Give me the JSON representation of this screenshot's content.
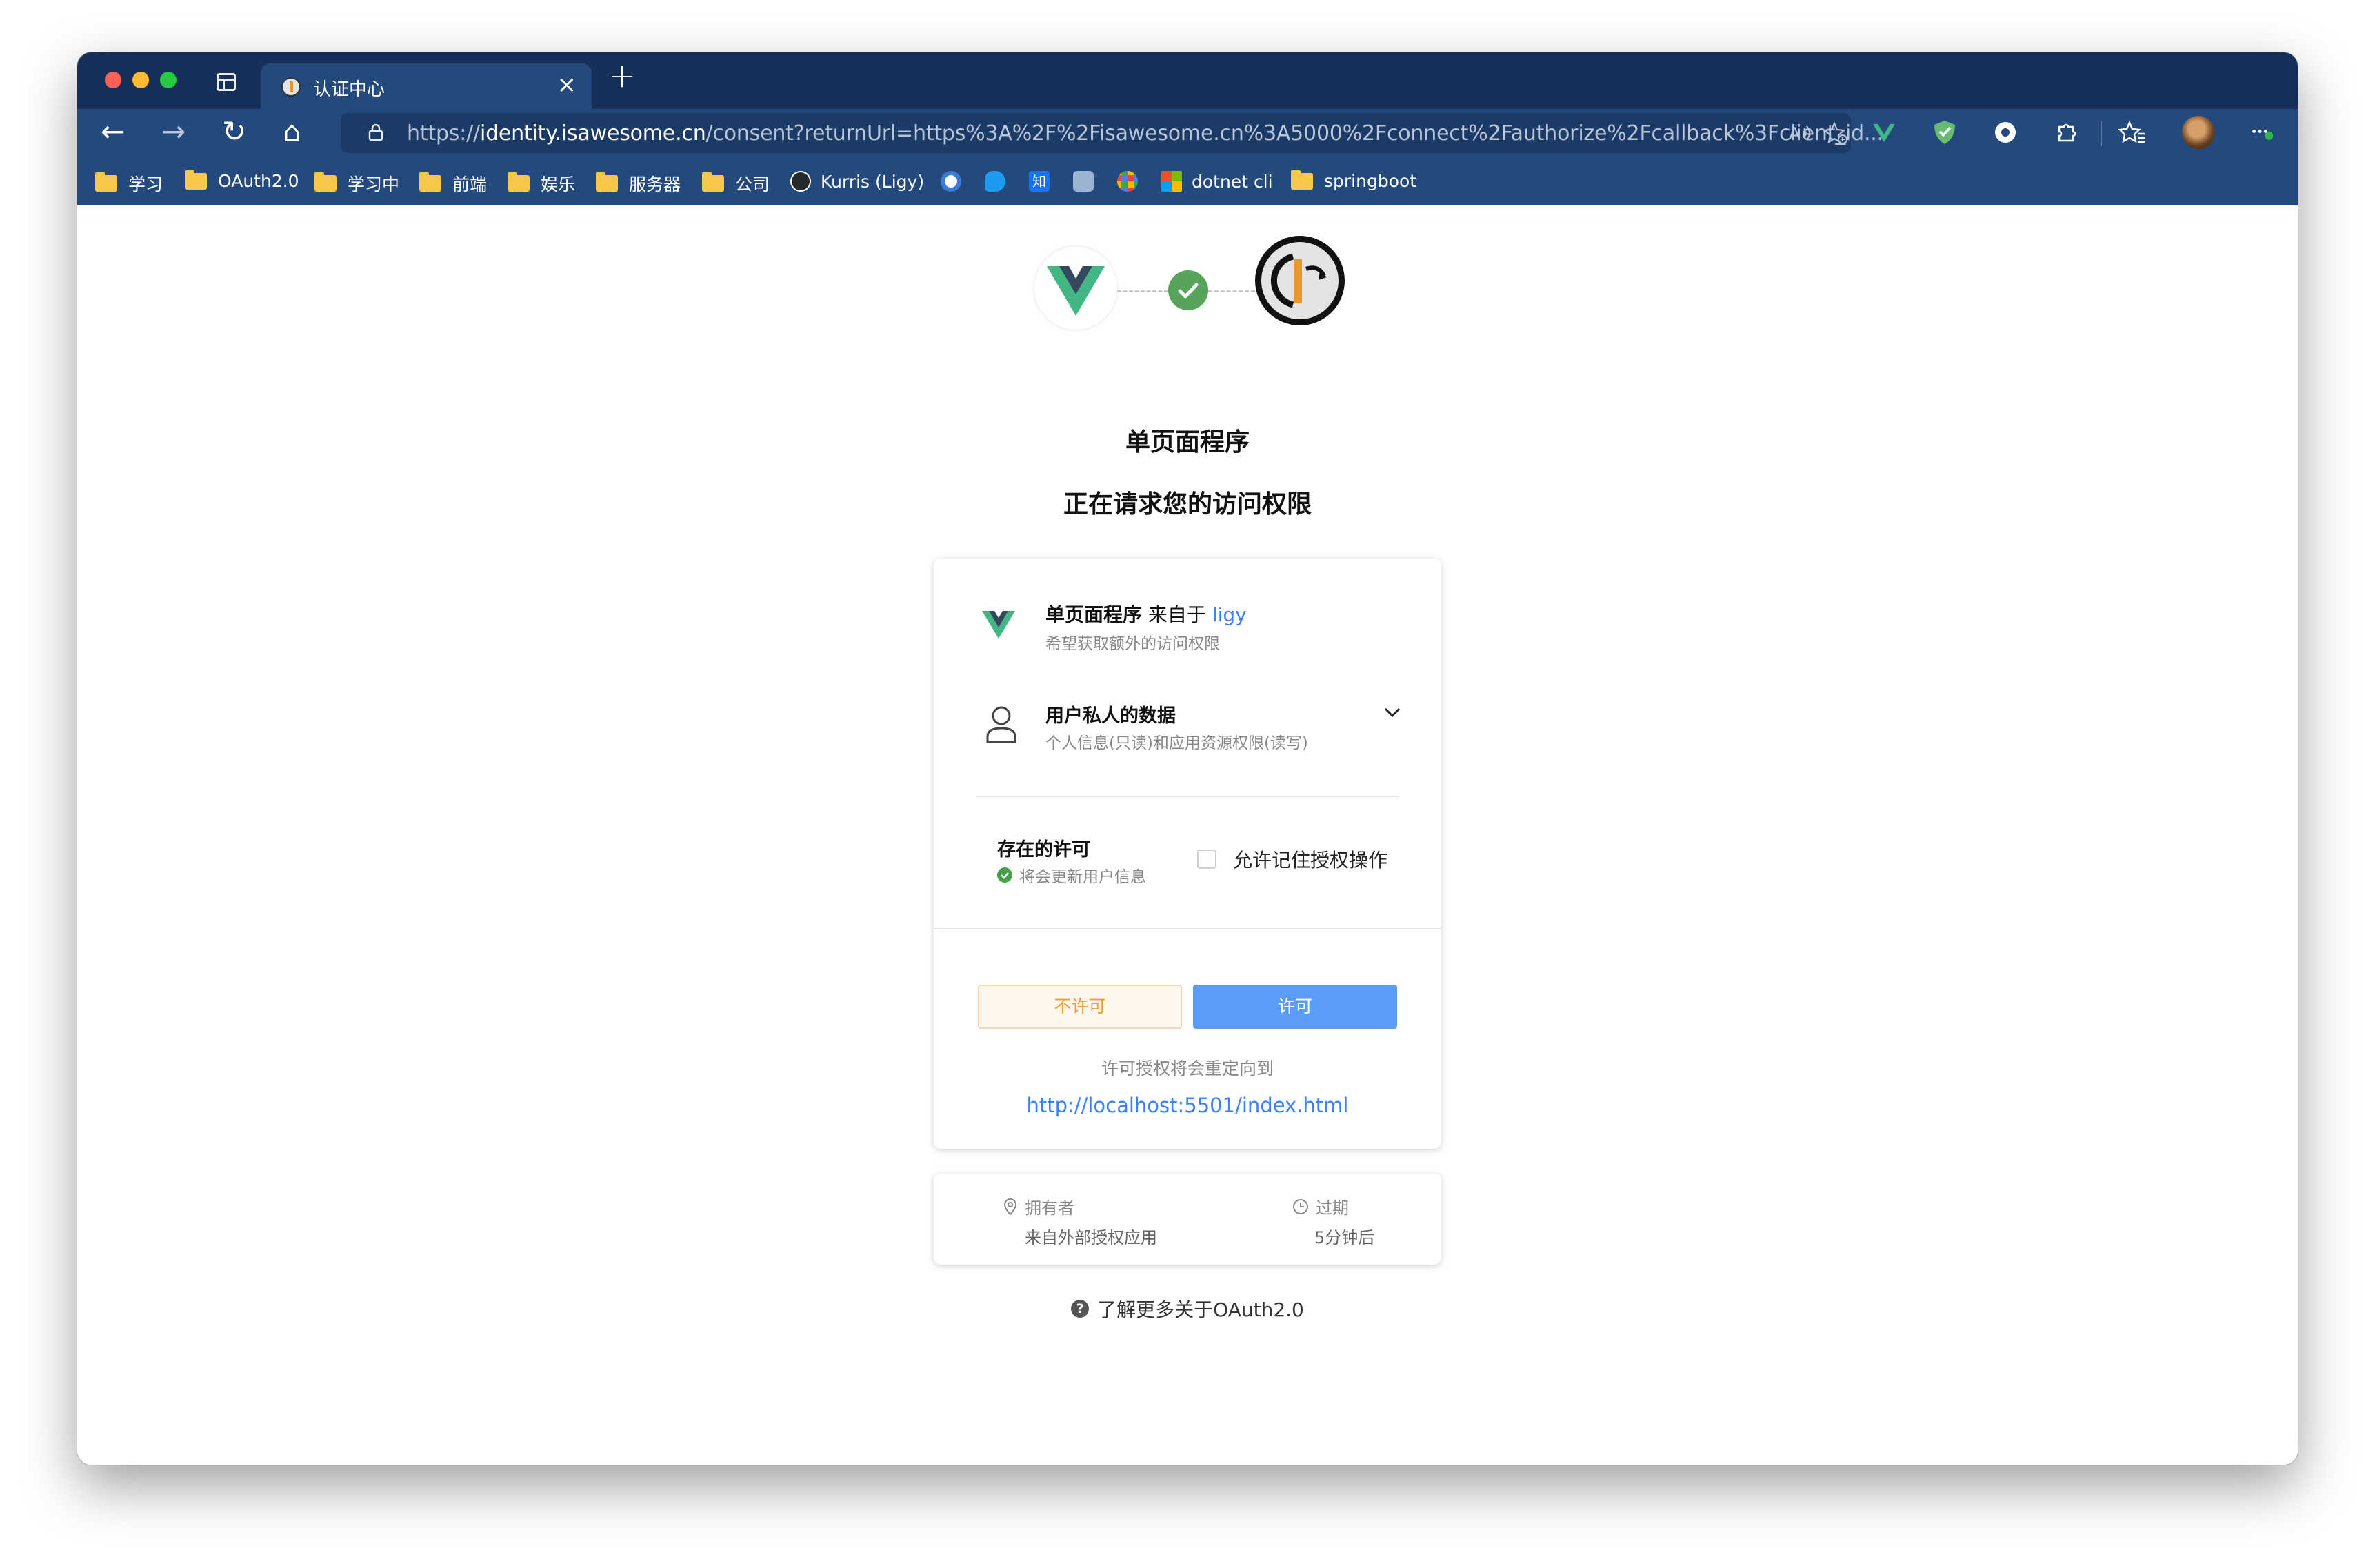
{
  "browser": {
    "tab": {
      "title": "认证中心",
      "close_glyph": "×"
    },
    "new_tab_glyph": "+",
    "nav": {
      "back_glyph": "←",
      "forward_glyph": "→",
      "reload_glyph": "↻",
      "home_glyph": "⌂"
    },
    "url": {
      "scheme": "https://",
      "host": "identity.isawesome.cn",
      "rest": "/consent?returnUrl=https%3A%2F%2Fisawesome.cn%3A5000%2Fconnect%2Fauthorize%2Fcallback%3Fclient_id..."
    },
    "omnibox_icons": [
      "read-aloud-icon",
      "add-favorite-icon"
    ],
    "extensions": [
      "vue-devtools-icon",
      "adguard-icon",
      "privacy-icon",
      "extensions-icon",
      "favorites-icon",
      "profile-avatar",
      "more-icon"
    ],
    "bookmarks": [
      {
        "label": "学习",
        "type": "folder"
      },
      {
        "label": "OAuth2.0",
        "type": "folder"
      },
      {
        "label": "学习中",
        "type": "folder"
      },
      {
        "label": "前端",
        "type": "folder"
      },
      {
        "label": "娱乐",
        "type": "folder"
      },
      {
        "label": "服务器",
        "type": "folder"
      },
      {
        "label": "公司",
        "type": "folder"
      },
      {
        "label": "Kurris (Ligy)",
        "type": "github"
      },
      {
        "label": "",
        "type": "site-c"
      },
      {
        "label": "",
        "type": "twitter"
      },
      {
        "label": "知",
        "type": "zhihu"
      },
      {
        "label": "",
        "type": "translate"
      },
      {
        "label": "",
        "type": "google"
      },
      {
        "label": "dotnet cli",
        "type": "microsoft"
      },
      {
        "label": "springboot",
        "type": "folder"
      }
    ]
  },
  "consent": {
    "app_name": "单页面程序",
    "request_title": "正在请求您的访问权限",
    "client": {
      "name": "单页面程序",
      "from_text": "来自于",
      "owner_link": "ligy",
      "subtitle": "希望获取额外的访问权限"
    },
    "scope": {
      "name": "用户私人的数据",
      "description": "个人信息(只读)和应用资源权限(读写)"
    },
    "existing_grant": {
      "title": "存在的许可",
      "note": "将会更新用户信息"
    },
    "remember_label": "允许记住授权操作",
    "deny_label": "不许可",
    "allow_label": "许可",
    "redirect_note": "许可授权将会重定向到",
    "redirect_url": "http://localhost:5501/index.html",
    "meta": {
      "owner_label": "拥有者",
      "owner_value": "来自外部授权应用",
      "expires_label": "过期",
      "expires_value": "5分钟后"
    },
    "learn_more": "了解更多关于OAuth2.0"
  },
  "colors": {
    "browser_frame": "#244a7d",
    "tabstrip": "#17305a",
    "link_blue": "#3b82f6",
    "allow_button": "#5a9cf8",
    "deny_button_text": "#e6a23c",
    "success_green": "#58a35a",
    "vue_green": "#41b883",
    "vue_dark": "#35495e"
  }
}
